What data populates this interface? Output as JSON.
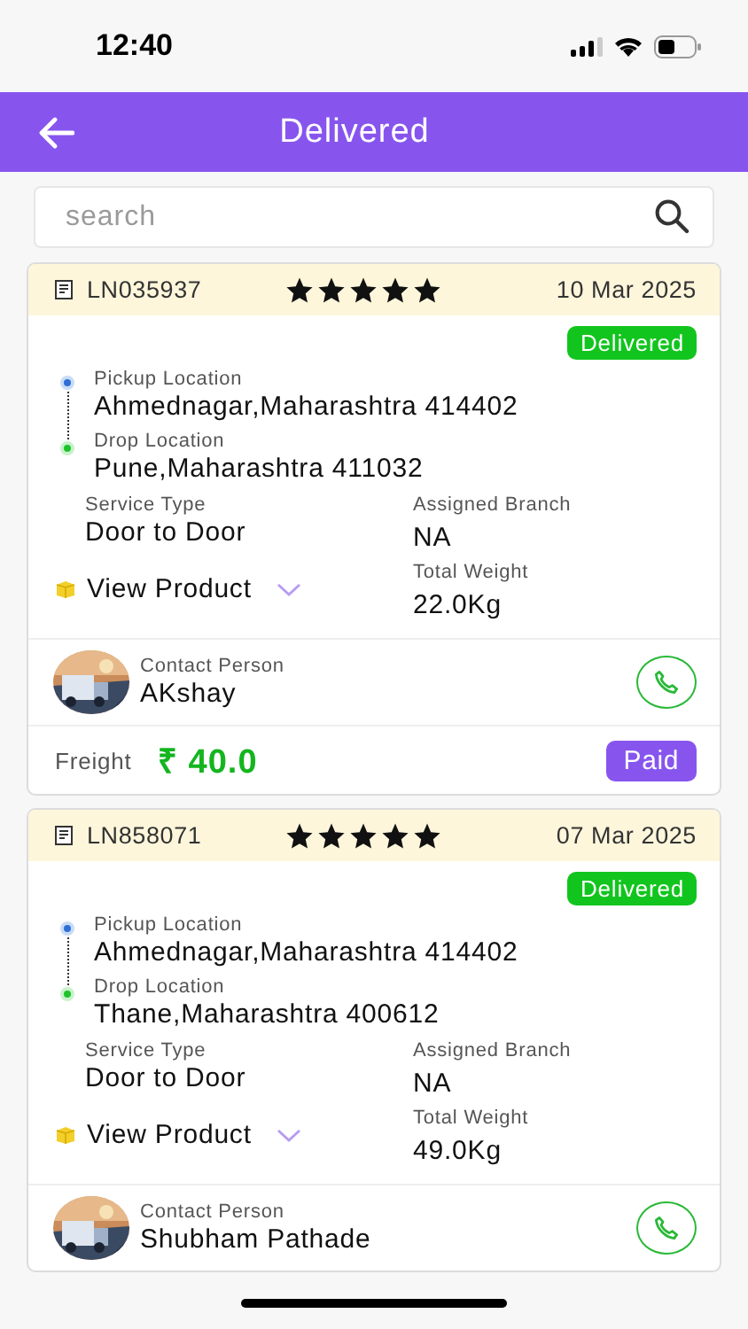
{
  "status_bar": {
    "time": "12:40"
  },
  "header": {
    "title": "Delivered"
  },
  "search": {
    "placeholder": "search"
  },
  "orders": [
    {
      "id": "LN035937",
      "stars": 5,
      "date": "10 Mar 2025",
      "status": "Delivered",
      "pickup_label": "Pickup Location",
      "pickup": "Ahmednagar,Maharashtra 414402",
      "drop_label": "Drop Location",
      "drop": "Pune,Maharashtra 411032",
      "service_label": "Service Type",
      "service": "Door to Door",
      "branch_label": "Assigned Branch",
      "branch": "NA",
      "product_link": "View Product",
      "weight_label": "Total Weight",
      "weight": "22.0Kg",
      "contact_label": "Contact Person",
      "contact": "AKshay",
      "freight_label": "Freight",
      "freight": "₹ 40.0",
      "payment": "Paid"
    },
    {
      "id": "LN858071",
      "stars": 5,
      "date": "07 Mar 2025",
      "status": "Delivered",
      "pickup_label": "Pickup Location",
      "pickup": "Ahmednagar,Maharashtra 414402",
      "drop_label": "Drop Location",
      "drop": "Thane,Maharashtra 400612",
      "service_label": "Service Type",
      "service": "Door to Door",
      "branch_label": "Assigned Branch",
      "branch": "NA",
      "product_link": "View Product",
      "weight_label": "Total Weight",
      "weight": "49.0Kg",
      "contact_label": "Contact Person",
      "contact": "Shubham Pathade"
    }
  ]
}
